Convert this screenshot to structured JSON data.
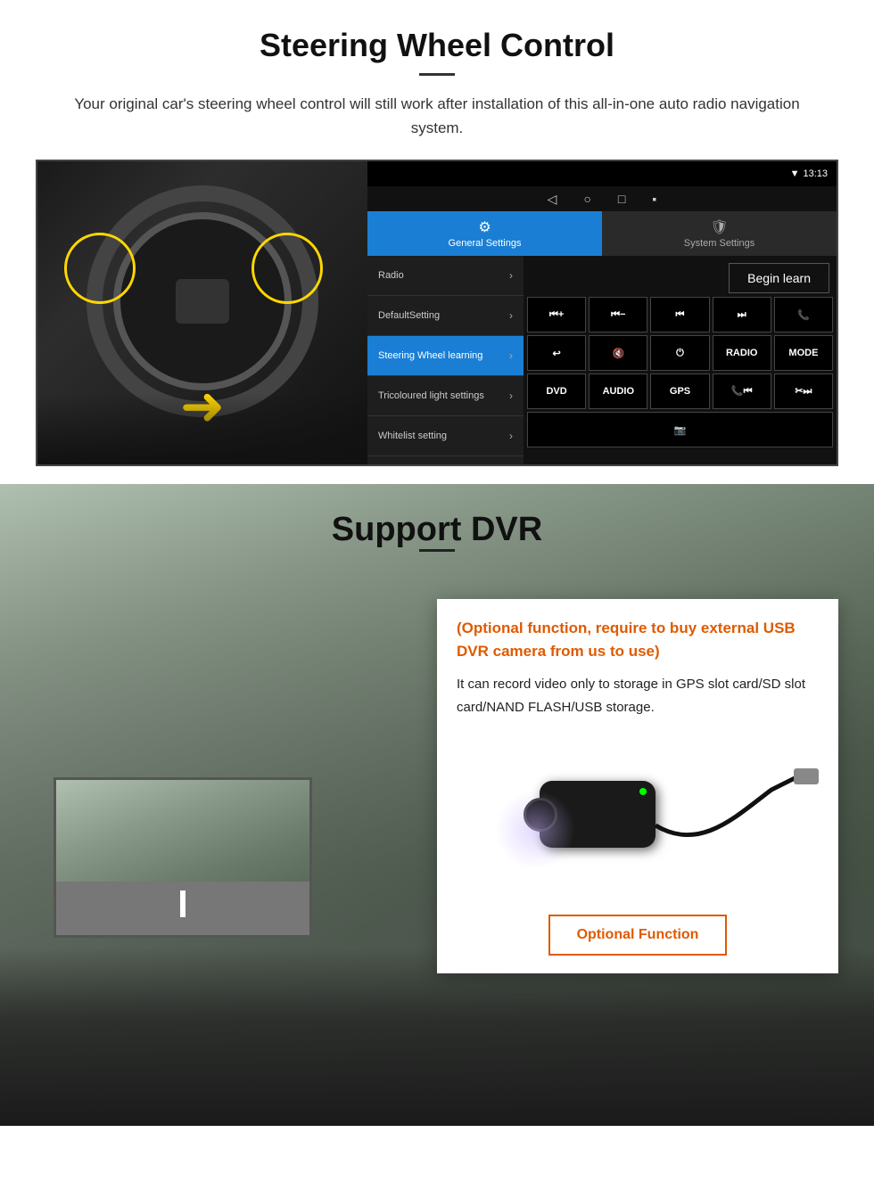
{
  "page": {
    "section1": {
      "title": "Steering Wheel Control",
      "description": "Your original car's steering wheel control will still work after installation of this all-in-one auto radio navigation system.",
      "android_ui": {
        "statusbar": {
          "time": "13:13",
          "signal_icon": "📶",
          "wifi_icon": "▼"
        },
        "nav_icons": [
          "◁",
          "○",
          "□",
          "▪"
        ],
        "tabs": [
          {
            "label": "General Settings",
            "active": true
          },
          {
            "label": "System Settings",
            "active": false
          }
        ],
        "menu_items": [
          {
            "label": "Radio",
            "active": false
          },
          {
            "label": "DefaultSetting",
            "active": false
          },
          {
            "label": "Steering Wheel learning",
            "active": true
          },
          {
            "label": "Tricoloured light settings",
            "active": false
          },
          {
            "label": "Whitelist setting",
            "active": false
          }
        ],
        "begin_learn_btn": "Begin learn",
        "control_buttons": {
          "row1": [
            "⏮+",
            "⏮−",
            "⏮",
            "⏭",
            "📞"
          ],
          "row2": [
            "↩",
            "🔇",
            "⏻",
            "RADIO",
            "MODE"
          ],
          "row3": [
            "DVD",
            "AUDIO",
            "GPS",
            "📞⏮",
            "✂⏭"
          ],
          "row4": [
            "📷"
          ]
        }
      }
    },
    "section2": {
      "title": "Support DVR",
      "optional_text": "(Optional function, require to buy external USB DVR camera from us to use)",
      "description": "It can record video only to storage in GPS slot card/SD slot card/NAND FLASH/USB storage.",
      "optional_function_btn": "Optional Function"
    }
  }
}
